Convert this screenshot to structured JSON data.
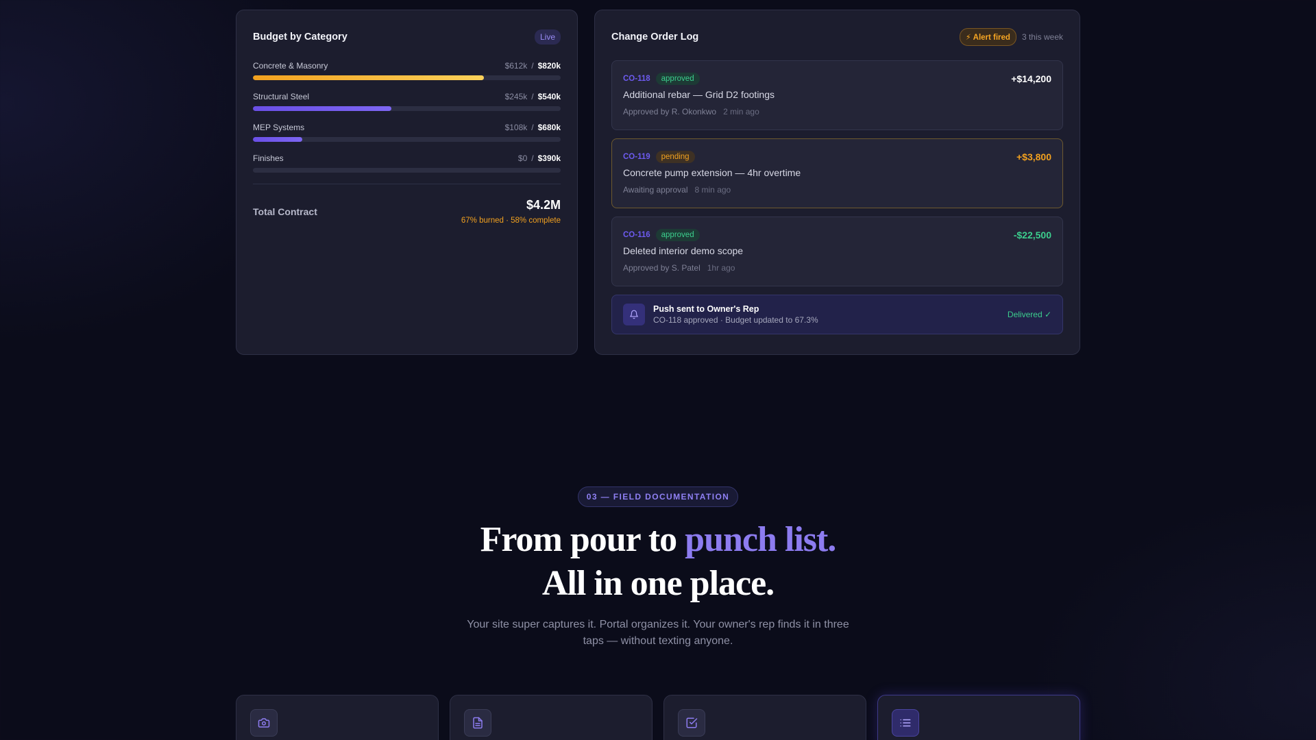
{
  "budget": {
    "title": "Budget by Category",
    "live_label": "Live",
    "categories": [
      {
        "name": "Concrete & Masonry",
        "spent": "$612k",
        "budget": "$820k",
        "progress": 0.75,
        "color": "amber"
      },
      {
        "name": "Structural Steel",
        "spent": "$245k",
        "budget": "$540k",
        "progress": 0.45,
        "color": "violet"
      },
      {
        "name": "MEP Systems",
        "spent": "$108k",
        "budget": "$680k",
        "progress": 0.16,
        "color": "violet"
      },
      {
        "name": "Finishes",
        "spent": "$0",
        "budget": "$390k",
        "progress": 0.0,
        "color": "violet"
      }
    ],
    "total_label": "Total Contract",
    "total_value": "$4.2M",
    "total_sub": "67% burned · 58% complete"
  },
  "change_orders": {
    "title": "Change Order Log",
    "alert_label": "⚡ Alert fired",
    "week_count": "3 this week",
    "items": [
      {
        "id": "CO-118",
        "status": "approved",
        "amount": "+$14,200",
        "description": "Additional rebar — Grid D2 footings",
        "by": "Approved by R. Okonkwo",
        "time": "2 min ago"
      },
      {
        "id": "CO-119",
        "status": "pending",
        "amount": "+$3,800",
        "description": "Concrete pump extension — 4hr overtime",
        "by": "Awaiting approval",
        "time": "8 min ago"
      },
      {
        "id": "CO-116",
        "status": "approved",
        "amount": "-$22,500",
        "description": "Deleted interior demo scope",
        "by": "Approved by S. Patel",
        "time": "1hr ago"
      }
    ],
    "push": {
      "title": "Push sent to Owner's Rep",
      "subtitle": "CO-118 approved · Budget updated to 67.3%",
      "status": "Delivered ✓"
    }
  },
  "section": {
    "eyebrow": "03 — FIELD DOCUMENTATION",
    "headline_part1": "From pour to ",
    "headline_accent": "punch list.",
    "headline_line2": "All in one place.",
    "lede": "Your site super captures it. Portal organizes it. Your owner's rep finds it in three taps — without texting anyone."
  },
  "features": [
    {
      "icon": "camera-icon"
    },
    {
      "icon": "document-icon"
    },
    {
      "icon": "checklist-icon"
    },
    {
      "icon": "list-icon"
    }
  ],
  "colors": {
    "background": "#0b0c1a",
    "panel": "#1c1d2e",
    "accent_violet": "#6d5bf0",
    "accent_amber": "#f2a11f",
    "accent_green": "#3ccf8e"
  }
}
